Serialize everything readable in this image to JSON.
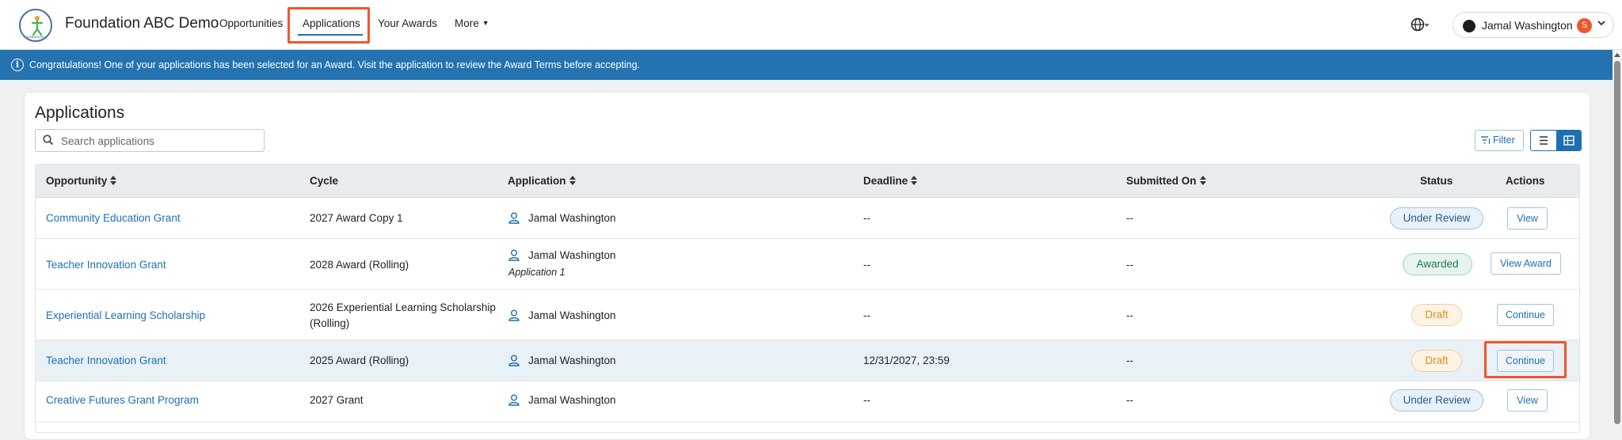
{
  "app": {
    "brand": "Foundation ABC Demo",
    "logo_label": "FOUNDATION ABC"
  },
  "nav": {
    "opportunities": "Opportunities",
    "applications": "Applications",
    "your_awards": "Your Awards",
    "more": "More",
    "user_name": "Jamal Washington",
    "user_badge": "S"
  },
  "banner": {
    "icon": "i",
    "message": "Congratulations! One of your applications has been selected for an Award. Visit the application to review the Award Terms before accepting."
  },
  "page": {
    "title": "Applications",
    "search_placeholder": "Search applications",
    "filter_label": "Filter"
  },
  "table": {
    "headers": {
      "opportunity": "Opportunity",
      "cycle": "Cycle",
      "application": "Application",
      "deadline": "Deadline",
      "submitted_on": "Submitted On",
      "status": "Status",
      "actions": "Actions"
    },
    "rows": [
      {
        "opportunity": "Community Education Grant",
        "cycle": "2027 Award Copy 1",
        "cycle2": "",
        "applicant": "Jamal Washington",
        "app_sub": "",
        "deadline": "--",
        "submitted": "--",
        "status": "Under Review",
        "action": "View"
      },
      {
        "opportunity": "Teacher Innovation Grant",
        "cycle": "2028 Award (Rolling)",
        "cycle2": "",
        "applicant": "Jamal Washington",
        "app_sub": "Application 1",
        "deadline": "--",
        "submitted": "--",
        "status": "Awarded",
        "action": "View Award"
      },
      {
        "opportunity": "Experiential Learning Scholarship",
        "cycle": "2026 Experiential Learning Scholarship",
        "cycle2": "(Rolling)",
        "applicant": "Jamal Washington",
        "app_sub": "",
        "deadline": "--",
        "submitted": "--",
        "status": "Draft",
        "action": "Continue"
      },
      {
        "opportunity": "Teacher Innovation Grant",
        "cycle": "2025 Award (Rolling)",
        "cycle2": "",
        "applicant": "Jamal Washington",
        "app_sub": "",
        "deadline": "12/31/2027, 23:59",
        "submitted": "--",
        "status": "Draft",
        "action": "Continue"
      },
      {
        "opportunity": "Creative Futures Grant Program",
        "cycle": "2027 Grant",
        "cycle2": "",
        "applicant": "Jamal Washington",
        "app_sub": "",
        "deadline": "--",
        "submitted": "--",
        "status": "Under Review",
        "action": "View"
      }
    ]
  },
  "colors": {
    "accent": "#1f6fb2",
    "banner": "#2473b0",
    "highlight": "#f2552c"
  }
}
